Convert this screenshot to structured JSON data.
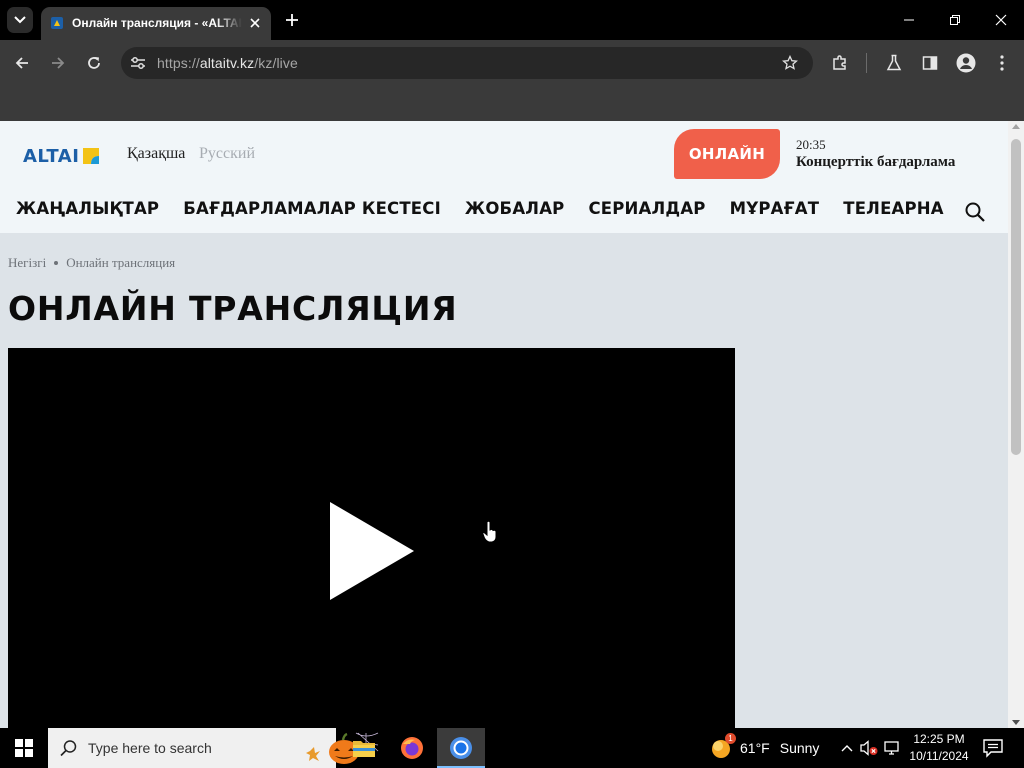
{
  "browser": {
    "tab_title": "Онлайн трансляция - «ALTAI»",
    "url_scheme": "https://",
    "url_host": "altaitv.kz",
    "url_path": "/kz/live"
  },
  "site": {
    "logo_text": "ALTAI",
    "languages": [
      "Қазақша",
      "Русский"
    ],
    "online_button": "ОНЛАЙН",
    "now_playing": {
      "time": "20:35",
      "title": "Концерттік бағдарлама"
    },
    "nav": [
      "ЖАҢАЛЫҚТАР",
      "БАҒДАРЛАМАЛАР КЕСТЕСІ",
      "ЖОБАЛАР",
      "СЕРИАЛДАР",
      "МҰРАҒАТ",
      "ТЕЛЕАРНА"
    ]
  },
  "breadcrumb": [
    "Негізгі",
    "Онлайн трансляция"
  ],
  "page_title": "ОНЛАЙН ТРАНСЛЯЦИЯ",
  "taskbar": {
    "search_placeholder": "Type here to search",
    "weather_temp": "61°F",
    "weather_desc": "Sunny",
    "weather_badge": "1",
    "time": "12:25 PM",
    "date": "10/11/2024"
  },
  "colors": {
    "online_accent": "#f0604a",
    "logo_blue": "#1c5fa7",
    "logo_yellow": "#f3c316",
    "header_bg": "#f1f6f9",
    "page_bg": "#dde3e8"
  }
}
